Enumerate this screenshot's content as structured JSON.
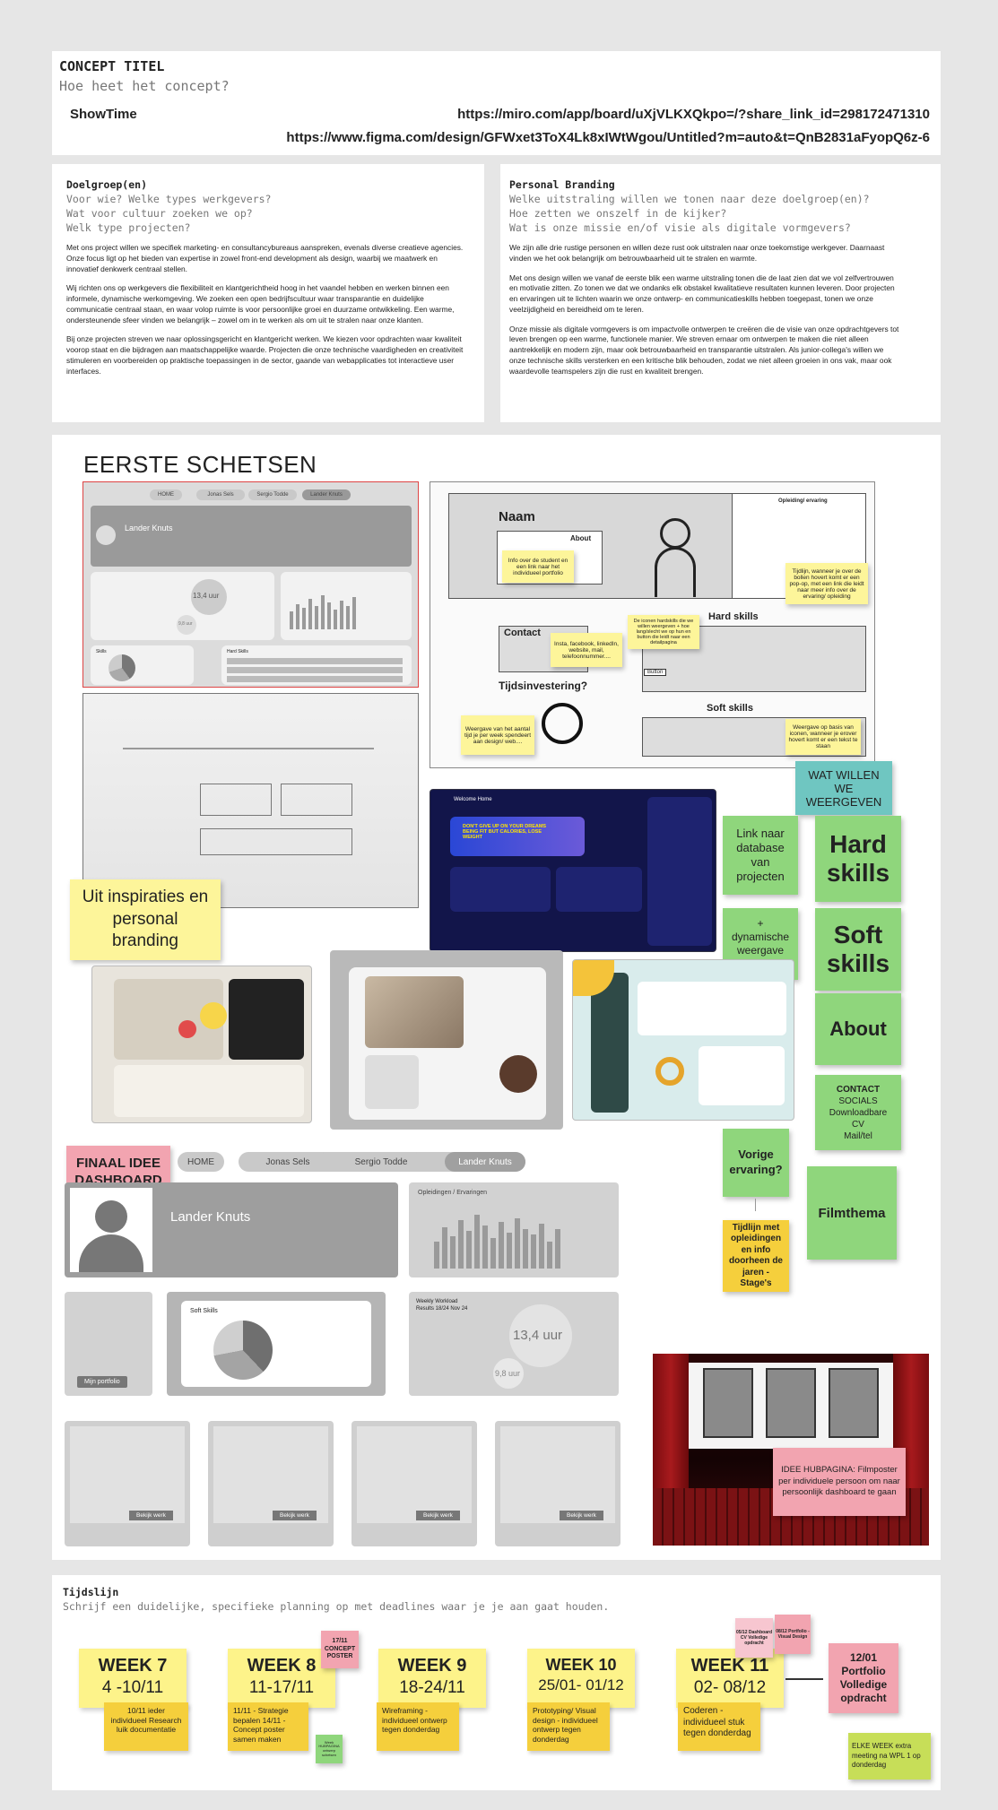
{
  "concept": {
    "title": "CONCEPT TITEL",
    "subtitle": "Hoe heet het concept?",
    "name": "ShowTime",
    "miro_link": "https://miro.com/app/board/uXjVLKXQkpo=/?share_link_id=298172471310",
    "figma_link": "https://www.figma.com/design/GFWxet3ToX4Lk8xIWtWgou/Untitled?m=auto&t=QnB2831aFyopQ6z-6"
  },
  "doelgroep": {
    "heading": "Doelgroep(en)",
    "q1": "Voor wie? Welke types werkgevers?",
    "q2": "Wat voor cultuur zoeken we op?",
    "q3": "Welk type projecten?",
    "p1": "Met ons project willen we specifiek marketing- en consultancybureaus aanspreken, evenals diverse creatieve agencies. Onze focus ligt op het bieden van expertise in zowel front-end development als design, waarbij we maatwerk en innovatief denkwerk centraal stellen.",
    "p2": "Wij richten ons op werkgevers die flexibiliteit en klantgerichtheid hoog in het vaandel hebben en werken binnen een informele, dynamische werkomgeving. We zoeken een open bedrijfscultuur waar transparantie en duidelijke communicatie centraal staan, en waar volop ruimte is voor persoonlijke groei en duurzame ontwikkeling. Een warme, ondersteunende sfeer vinden we belangrijk – zowel om in te werken als om uit te stralen naar onze klanten.",
    "p3": "Bij onze projecten streven we naar oplossingsgericht en klantgericht werken. We kiezen voor opdrachten waar kwaliteit voorop staat en die bijdragen aan maatschappelijke waarde. Projecten die onze technische vaardigheden en creativiteit stimuleren en voorbereiden op praktische toepassingen in de sector, gaande van webapplicaties tot interactieve user interfaces."
  },
  "branding": {
    "heading": "Personal Branding",
    "q1": "Welke uitstraling willen we tonen naar deze doelgroep(en)?",
    "q2": "Hoe zetten we onszelf in de kijker?",
    "q3": "Wat is onze missie en/of visie als digitale vormgevers?",
    "p1": "We zijn alle drie rustige personen en willen deze rust ook uitstralen naar onze toekomstige werkgever. Daarnaast vinden we het ook belangrijk om betrouwbaarheid uit te stralen en warmte.",
    "p2": "Met ons design willen we vanaf de eerste blik een warme uitstraling tonen die de laat zien dat we vol zelfvertrouwen en motivatie zitten. Zo tonen we dat we ondanks elk obstakel kwalitatieve resultaten kunnen leveren. Door projecten en ervaringen uit te lichten waarin we onze ontwerp- en communicatieskills hebben toegepast, tonen we onze veelzijdigheid en bereidheid om te leren.",
    "p3": "Onze missie als digitale vormgevers is om impactvolle ontwerpen te creëren die de visie van onze opdrachtgevers tot leven brengen op een warme, functionele manier. We streven ernaar om ontwerpen te maken die niet alleen aantrekkelijk en modern zijn, maar ook betrouwbaarheid en transparantie uitstralen. Als junior-collega's willen we onze technische skills versterken en een kritische blik behouden, zodat we niet alleen groeien in ons vak, maar ook waardevolle teamspelers zijn die rust en kwaliteit brengen."
  },
  "sketches": {
    "heading": "EERSTE SCHETSEN",
    "wire1": {
      "tabs": [
        "HOME",
        "Jonas Sels",
        "Sergio Todde",
        "Lander Knuts"
      ],
      "name": "Lander Knuts",
      "hours": "13,4 uur",
      "hours2": "9,8 uur",
      "skills_label": "Skills",
      "hard_label": "Hard Skills"
    },
    "drawing": {
      "naam": "Naam",
      "about": "About",
      "opl": "Opleiding/ ervaring",
      "contact": "Contact",
      "hard": "Hard skills",
      "tijd": "Tijdsinvestering?",
      "soft": "Soft skills",
      "btn": "Button",
      "n_about": "Info over de student en een link naar het individueel portfolio",
      "n_tijd": "Tijdlijn, wanneer je over de bollen hovert komt er een pop-op, met een link die leidt naar meer info over de ervaring/ opleiding",
      "n_contact": "Insta, facebook, linkedIn, website, mail, telefoonnummer....",
      "n_hard": "De iconen hardskills die we willen weergeven + hoe lang/slecht we op hun en button die leidt naar een detailpagina",
      "n_time": "Weergave van het aantal tijd je per week spendeert aan design/ web....",
      "n_soft": "Weergave op basis van iconen, wanneer je erover hovert komt er een tekst te staan"
    },
    "inspiratie": "Uit inspiraties en personal branding",
    "dash": {
      "welcome": "Welcome Home",
      "promo": "DON'T GIVE UP ON YOUR DREAMS BEING FIT BUT CALORIES, LOSE WEIGHT"
    }
  },
  "notes": {
    "wat": "WAT WILLEN WE WEERGEVEN",
    "link": "Link naar database van projecten",
    "dyn": "+ dynamische weergave vooruitgang",
    "hard": "Hard skills",
    "soft": "Soft skills",
    "about": "About",
    "contact_title": "CONTACT",
    "contact_items": [
      "SOCIALS",
      "Downloadbare CV",
      "Mail/tel"
    ],
    "vorige": "Vorige ervaring?",
    "tijdlijn": "Tijdlijn met opleidingen en info doorheen de jaren - Stage's",
    "film": "Filmthema"
  },
  "final": {
    "label": "FINAAL IDEE DASHBOARD",
    "tabs": [
      "HOME",
      "Jonas Sels",
      "Sergio Todde",
      "Lander Knuts"
    ],
    "name": "Lander Knuts",
    "opl": "Opleidingen / Ervaringen",
    "soft": "Soft Skills",
    "workload": "Weekly Workload",
    "period": "Results 18/24 Nov 24",
    "hours": "13,4 uur",
    "hours2": "9,8 uur",
    "portfolio": "Mijn portfolio",
    "bekijk": "Bekijk werk"
  },
  "hub": {
    "text": "IDEE HUBPAGINA: Filmposter per individuele persoon om naar persoonlijk dashboard te gaan"
  },
  "timeline": {
    "heading": "Tijdslijn",
    "sub": "Schrijf een duidelijke, specifieke planning op met deadlines waar je je aan gaat houden.",
    "weeks": [
      {
        "w": "WEEK 7",
        "d": "4 -10/11"
      },
      {
        "w": "WEEK 8",
        "d": "11-17/11"
      },
      {
        "w": "WEEK 9",
        "d": "18-24/11"
      },
      {
        "w": "WEEK 10",
        "d": "25/01- 01/12"
      },
      {
        "w": "WEEK 11",
        "d": "02- 08/12"
      }
    ],
    "n7": "10/11 ieder individueel Research luik documentatie",
    "n8": "11/11 - Strategie bepalen 14/11 - Concept poster samen maken",
    "n8b": "17/11 CONCEPT POSTER",
    "n8c": "Week HUBPAGINA ontwerp schetsen",
    "n9": "Wireframing - individueel ontwerp tegen donderdag",
    "n10": "Prototyping/ Visual design - individueel ontwerp tegen donderdag",
    "n11": "Coderen - individueel stuk tegen donderdag",
    "p1": "05/12 Dashboard CV Volledige opdracht",
    "p2": "08/12 Portfolio - Visual Design",
    "final": "12/01 Portfolio Volledige opdracht",
    "elke": "ELKE WEEK extra meeting na WPL 1 op donderdag"
  }
}
